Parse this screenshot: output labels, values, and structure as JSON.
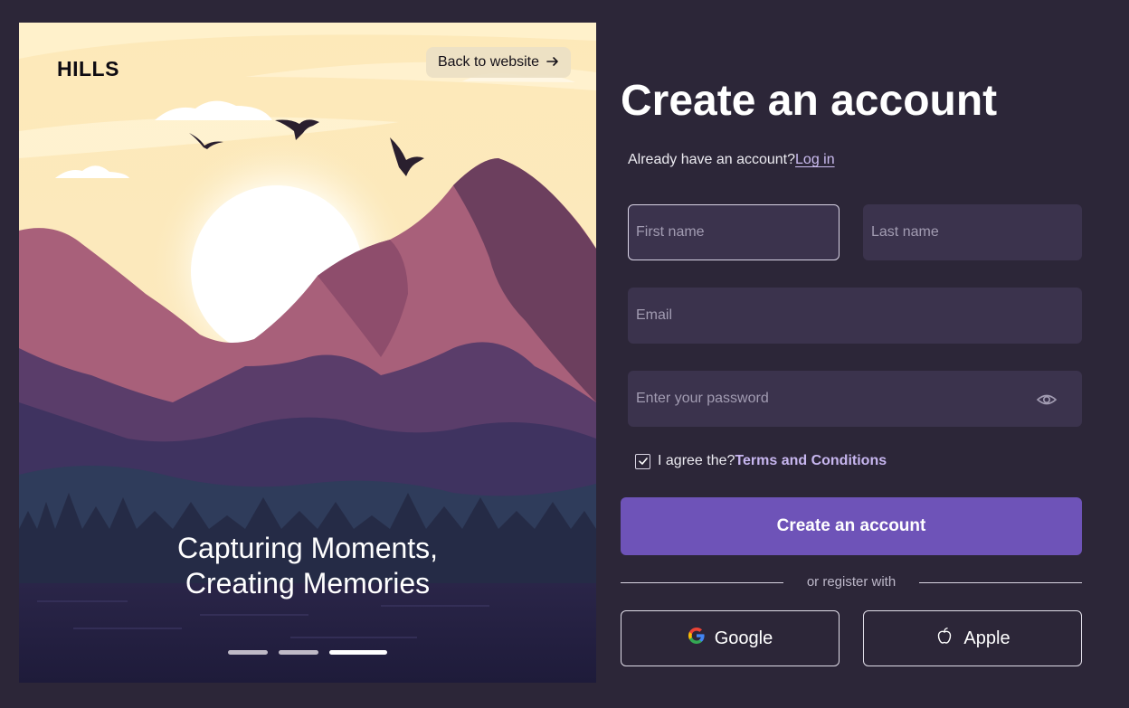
{
  "hero": {
    "brand": "HILLS",
    "back_label": "Back to website",
    "tagline_line1": "Capturing Moments,",
    "tagline_line2": "Creating Memories",
    "slides_total": 3,
    "slide_active": 3
  },
  "form": {
    "title": "Create an account",
    "login_prompt": "Already have an account?",
    "login_link": "Log in",
    "first_name_placeholder": "First name",
    "last_name_placeholder": "Last name",
    "email_placeholder": "Email",
    "password_placeholder": "Enter your password",
    "agree_text": "I agree the?",
    "terms_link": "Terms and Conditions",
    "agree_checked": true,
    "submit_label": "Create an account",
    "divider_text": "or  register with",
    "google_label": "Google",
    "apple_label": "Apple"
  },
  "colors": {
    "background": "#2c2638",
    "input_bg": "#3b334d",
    "accent": "#6e53b8",
    "link": "#cbbcf0"
  },
  "icons": [
    "arrow-right-icon",
    "eye-icon",
    "checkbox-checked-icon",
    "google-logo-icon",
    "apple-logo-icon"
  ]
}
